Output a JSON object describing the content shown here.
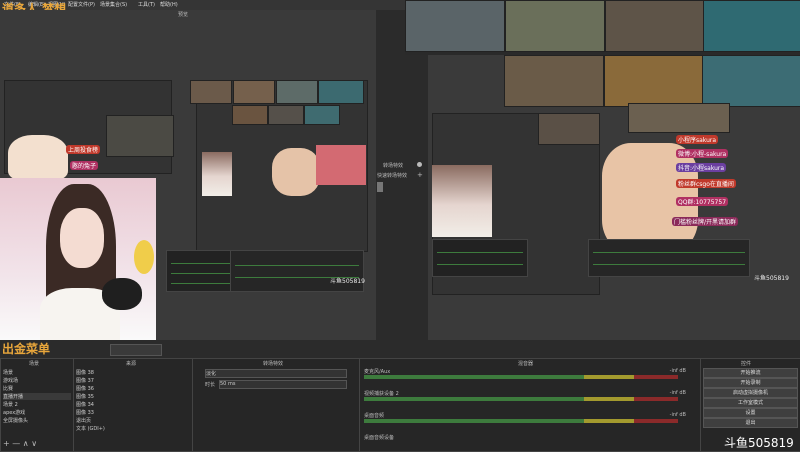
{
  "overlay": {
    "title_left": "道多人   梦想",
    "bottom_left": "出金菜单",
    "douyu_preview": "斗鱼505819",
    "douyu_program": "斗鱼505819",
    "douyu_bottom": "斗鱼505819"
  },
  "menu": {
    "items": [
      "文件(F)",
      "编辑(E)",
      "视图(V)",
      "配置文件(P)",
      "场景集合(S)",
      "工具(T)",
      "帮助(H)"
    ]
  },
  "preview_label": "预览",
  "banner_left": {
    "line1": "上周投食榜",
    "line2": "憨的兔子"
  },
  "transition": {
    "label": "转场特效",
    "quick": "快速转场特效"
  },
  "banner_right": {
    "lines": [
      "小程序sakura",
      "微博:小程-sakura",
      "抖音:小程sakura",
      "粉丝群csgo在直播间",
      "QQ群:10775757",
      "门槛粉丝牌/开黑请加群"
    ]
  },
  "panels": {
    "scenes": {
      "title": "场景",
      "items": [
        "场景",
        "游戏场",
        "比赛",
        "直播开播",
        "场景 2",
        "apex游戏",
        "全屏摄像头"
      ]
    },
    "sources": {
      "title": "来源",
      "items": [
        "图像 38",
        "图像 37",
        "图像 36",
        "图像 35",
        "图像 34",
        "图像 33",
        "退出页",
        "文本 (GDI+)"
      ]
    },
    "transitions": {
      "title": "转场特效",
      "type_value": "淡化",
      "duration_label": "时长",
      "duration_value": "50 ms"
    },
    "mixer": {
      "title": "混音器",
      "rows": [
        {
          "name": "麦克风/Aux",
          "db": "-inf dB"
        },
        {
          "name": "视频捕获设备 2",
          "db": "-inf dB"
        },
        {
          "name": "桌面音频",
          "db": "-inf dB"
        },
        {
          "name": "桌面音频设备",
          "db": ""
        }
      ]
    },
    "controls": {
      "title": "控件",
      "buttons": [
        "开始推流",
        "开始录制",
        "启动虚拟摄像机",
        "工作室模式",
        "设置",
        "退出"
      ]
    }
  },
  "colors": {
    "accent": "#3d7b3d",
    "warning": "#a39a2e",
    "danger": "#8b2a2a"
  }
}
